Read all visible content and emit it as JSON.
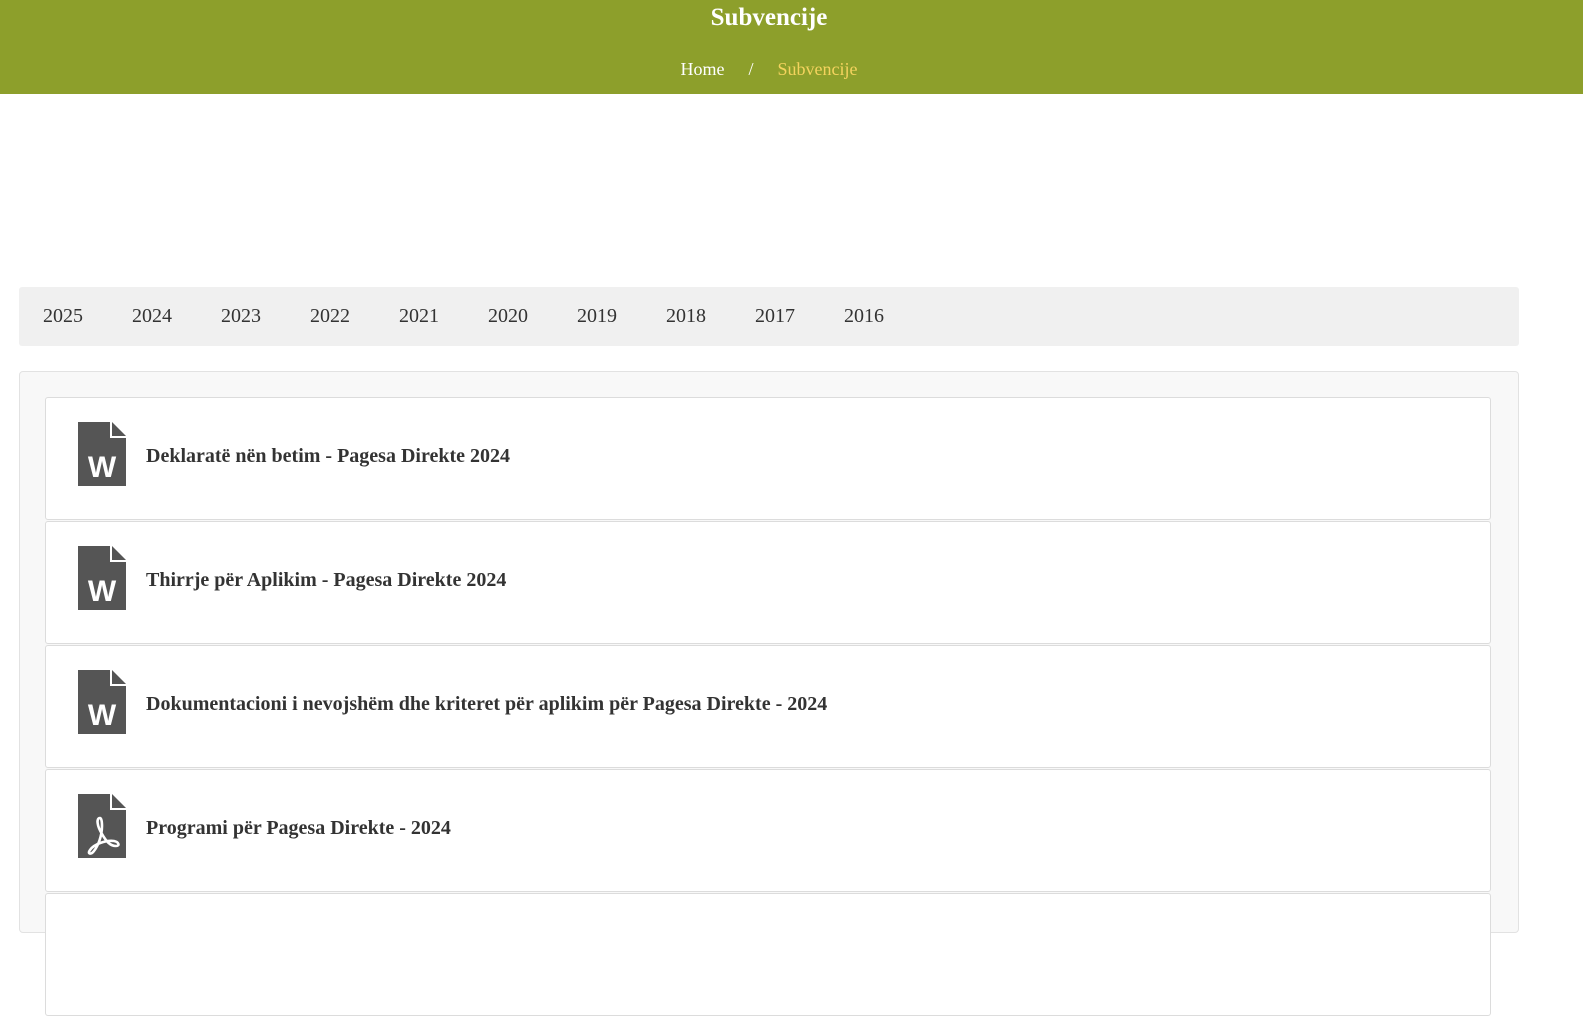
{
  "header": {
    "title": "Subvencije",
    "breadcrumb": {
      "home": "Home",
      "separator": "/",
      "current": "Subvencije"
    },
    "background_color": "#8d9f2b",
    "current_crumb_color": "#f4d35e"
  },
  "years": [
    "2025",
    "2024",
    "2023",
    "2022",
    "2021",
    "2020",
    "2019",
    "2018",
    "2017",
    "2016"
  ],
  "documents": [
    {
      "title": "Deklaratë nën betim - Pagesa Direkte 2024",
      "icon": "word-file-icon"
    },
    {
      "title": "Thirrje për Aplikim - Pagesa Direkte 2024",
      "icon": "word-file-icon"
    },
    {
      "title": "Dokumentacioni i nevojshëm dhe kriteret për aplikim për Pagesa Direkte - 2024",
      "icon": "word-file-icon"
    },
    {
      "title": "Programi për Pagesa Direkte - 2024",
      "icon": "pdf-file-icon"
    }
  ]
}
